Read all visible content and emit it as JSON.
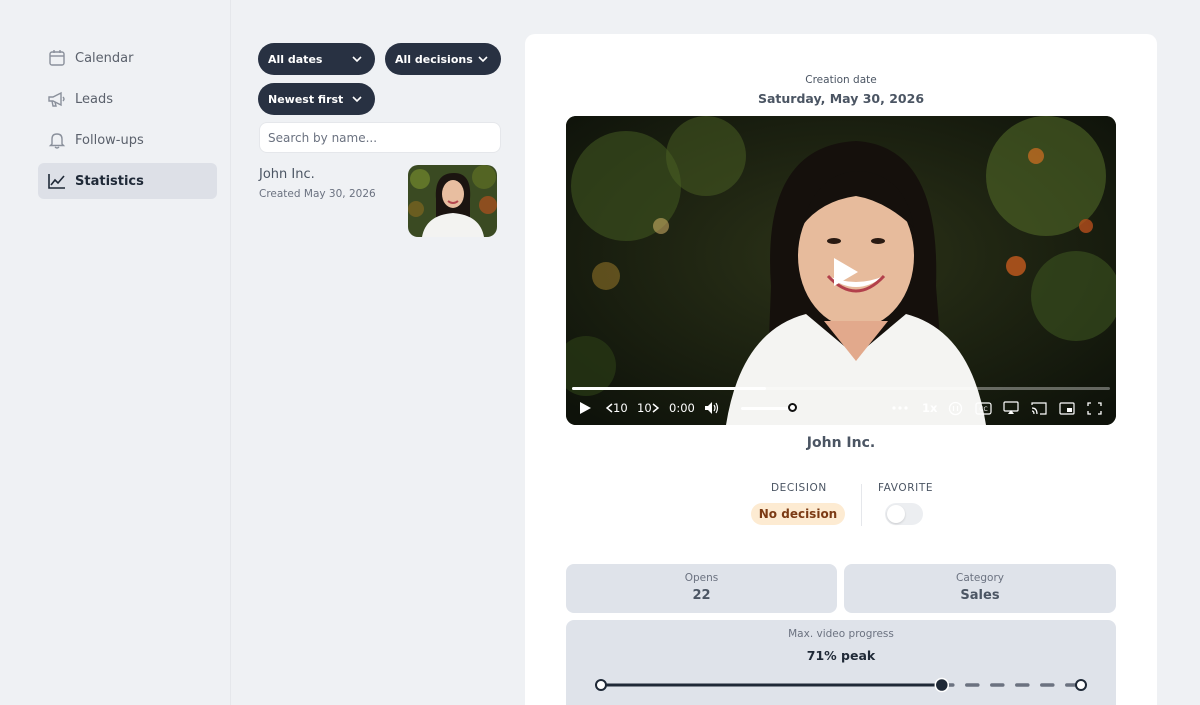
{
  "sidebar": {
    "items": [
      {
        "label": "Calendar",
        "icon": "calendar-icon"
      },
      {
        "label": "Leads",
        "icon": "megaphone-icon"
      },
      {
        "label": "Follow-ups",
        "icon": "bell-icon"
      },
      {
        "label": "Statistics",
        "icon": "chart-line-icon",
        "active": true
      }
    ]
  },
  "filters": {
    "dates": "All dates",
    "decisions": "All decisions",
    "sort": "Newest first",
    "search_placeholder": "Search by name..."
  },
  "list": [
    {
      "name": "John Inc.",
      "created": "Created May 30, 2026"
    }
  ],
  "detail": {
    "creation_label": "Creation date",
    "creation_date": "Saturday, May 30, 2026",
    "title": "John Inc.",
    "decision_label": "DECISION",
    "decision_value": "No decision",
    "favorite_label": "FAVORITE",
    "favorite_on": false,
    "stats": [
      {
        "label": "Opens",
        "value": "22"
      },
      {
        "label": "Category",
        "value": "Sales"
      }
    ],
    "progress_label": "Max. video progress",
    "progress_value": "71% peak",
    "progress_fraction": 0.71
  },
  "player": {
    "time": "0:00",
    "rewind": "10",
    "forward": "10",
    "speed": "1x",
    "played_fraction": 0.36,
    "volume_fraction": 0.9
  },
  "colors": {
    "pill_bg": "#283142",
    "active_nav": "#dde0e7",
    "badge_bg": "#fdebd2",
    "badge_text": "#7b3a14",
    "card_bg": "#dfe3ea"
  }
}
